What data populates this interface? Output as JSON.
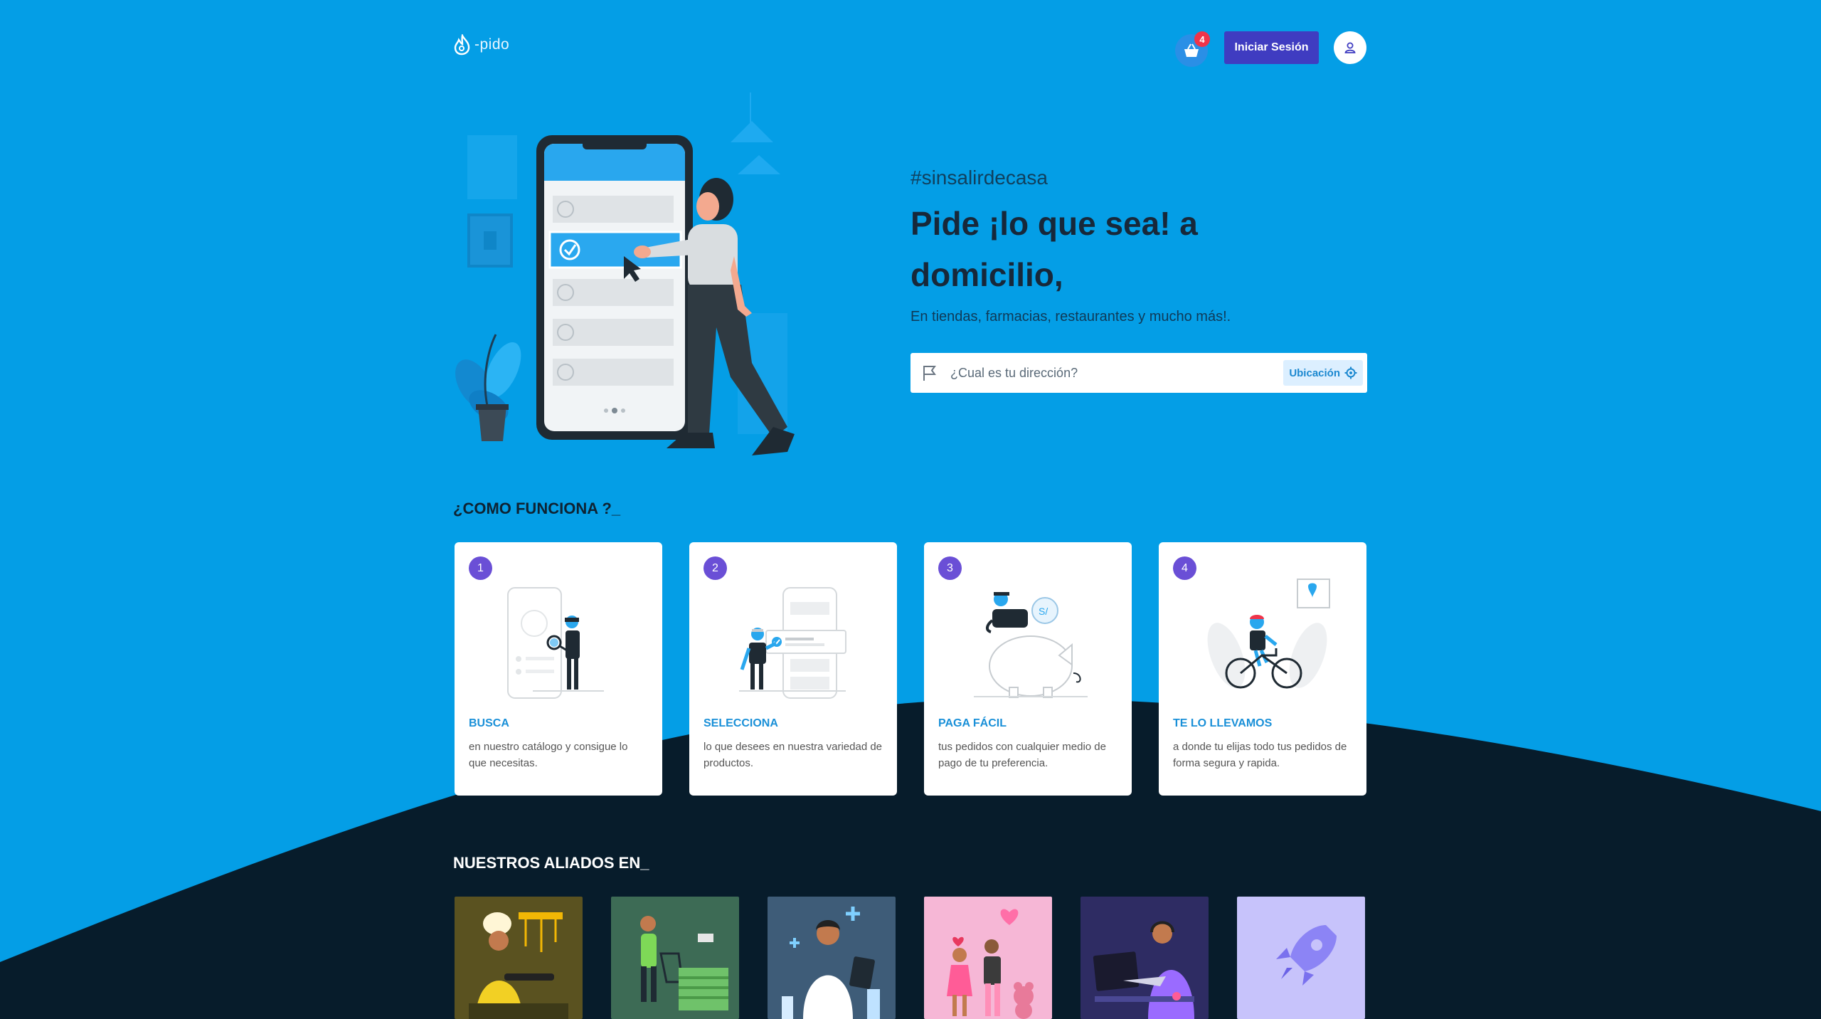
{
  "header": {
    "logo_text": "-pido",
    "cart_count": "4",
    "login_label": "Iniciar Sesión"
  },
  "hero": {
    "hashtag": "#sinsalirdecasa",
    "title": "Pide ¡lo que sea! a domicilio,",
    "subtitle": "En tiendas, farmacias, restaurantes y mucho más!.",
    "search_placeholder": "¿Cual es tu dirección?",
    "location_label": "Ubicación"
  },
  "how": {
    "title": "¿COMO FUNCIONA ?_",
    "steps": [
      {
        "num": "1",
        "title": "BUSCA",
        "desc": "en nuestro catálogo y consigue lo que necesitas."
      },
      {
        "num": "2",
        "title": "SELECCIONA",
        "desc": "lo que desees en nuestra variedad de productos."
      },
      {
        "num": "3",
        "title": "PAGA FÁCIL",
        "desc": "tus pedidos con cualquier medio de pago de tu preferencia."
      },
      {
        "num": "4",
        "title": "TE LO LLEVAMOS",
        "desc": "a donde tu elijas todo tus pedidos de forma segura y rapida."
      }
    ]
  },
  "allies": {
    "title": "NUESTROS ALIADOS EN_",
    "tiles": [
      {
        "icon": "chef-illustration",
        "color": "#5a5220"
      },
      {
        "icon": "grocery-illustration",
        "color": "#3d6b55"
      },
      {
        "icon": "pharmacy-illustration",
        "color": "#3e5c78"
      },
      {
        "icon": "gifts-illustration",
        "color": "#f6b7d6"
      },
      {
        "icon": "tech-support-illustration",
        "color": "#2e2c63"
      },
      {
        "icon": "rocket-illustration",
        "color": "#c7c3fb"
      }
    ]
  },
  "colors": {
    "background": "#049ee6",
    "dark_wave": "#071c2b",
    "primary_button": "#3f3cc1",
    "step_badge": "#6a4fd6",
    "badge_red": "#f0344a"
  }
}
